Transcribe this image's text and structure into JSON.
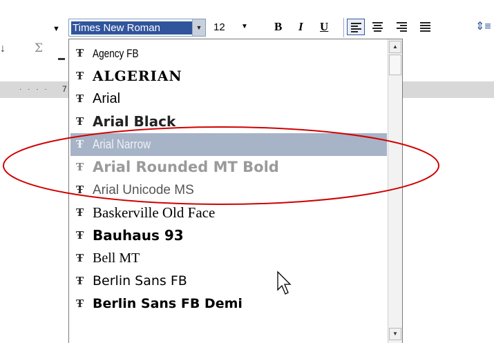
{
  "toolbar": {
    "font_name_value": "Times New Roman",
    "font_size_value": "12",
    "bold_label": "B",
    "italic_label": "I",
    "underline_label": "U"
  },
  "left_strip": {
    "sort_glyph": "↓",
    "sum_glyph": "Σ"
  },
  "ruler": {
    "marks": "· · · ·",
    "number": "7"
  },
  "font_list": {
    "items": [
      {
        "label": "Agency FB"
      },
      {
        "label": "ALGERIAN"
      },
      {
        "label": "Arial"
      },
      {
        "label": "Arial Black"
      },
      {
        "label": "Arial Narrow",
        "selected": true
      },
      {
        "label": "Arial Rounded MT Bold"
      },
      {
        "label": "Arial Unicode MS"
      },
      {
        "label": "Baskerville Old Face"
      },
      {
        "label": "Bauhaus 93"
      },
      {
        "label": "Bell MT"
      },
      {
        "label": "Berlin Sans FB"
      },
      {
        "label": "Berlin Sans FB Demi"
      }
    ]
  },
  "icons": {
    "font_item": "truetype-font-icon",
    "cursor": "mouse-pointer-icon"
  },
  "colors": {
    "selection_highlight": "#a7b3c7",
    "combo_selection": "#31559c",
    "annotation": "#d00000"
  }
}
